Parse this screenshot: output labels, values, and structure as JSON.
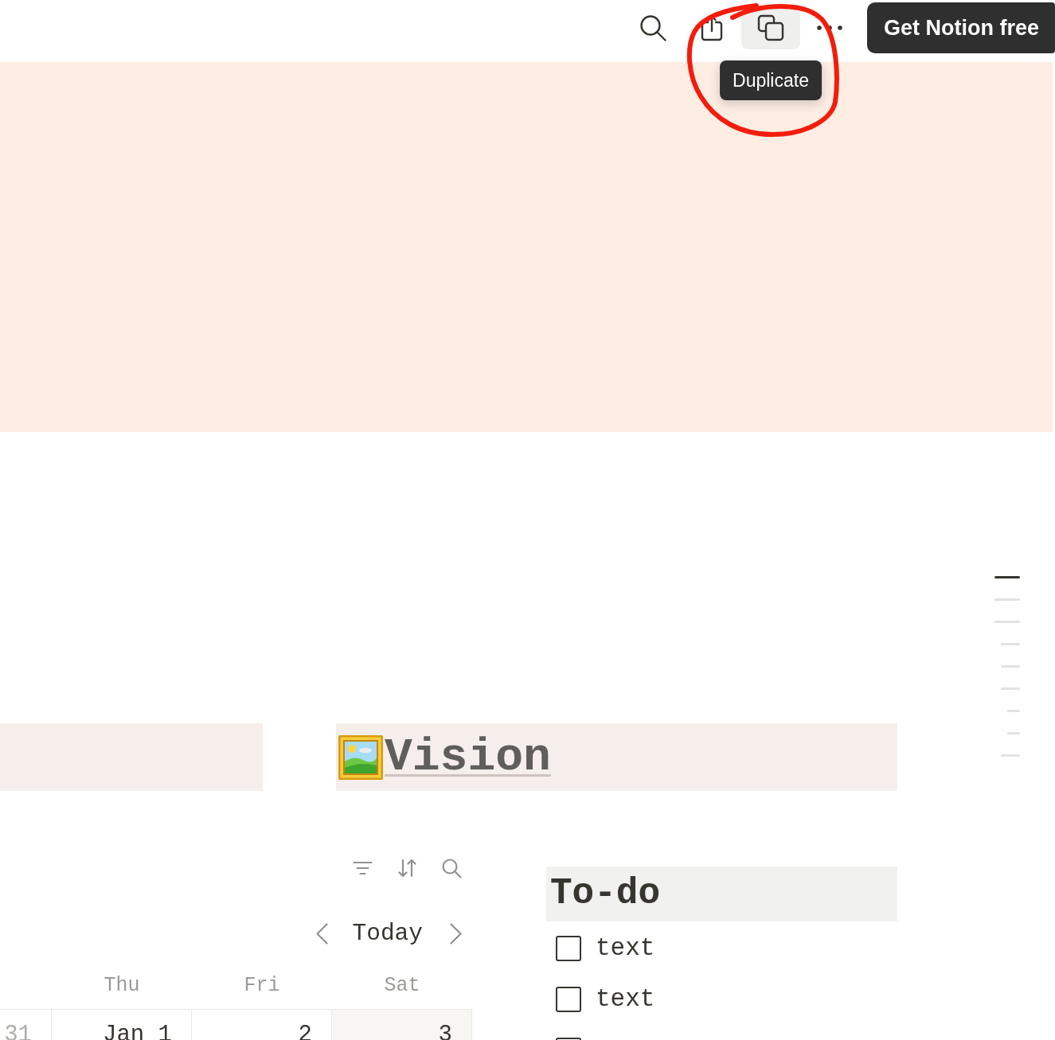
{
  "topbar": {
    "buttons": [
      {
        "kind": "search",
        "hovered": false
      },
      {
        "kind": "share",
        "hovered": false
      },
      {
        "kind": "duplicate",
        "hovered": true,
        "tooltip": "Duplicate"
      },
      {
        "kind": "more",
        "hovered": false
      }
    ],
    "cta": "Get Notion free"
  },
  "outline": [
    {
      "selected": true
    },
    {
      "selected": false
    },
    {
      "selected": false,
      "children": [
        {
          "selected": false
        },
        {
          "selected": false
        },
        {
          "selected": false,
          "children": [
            {
              "selected": false
            },
            {
              "selected": false
            }
          ]
        },
        {
          "selected": false
        }
      ]
    }
  ],
  "vision_link": {
    "title": "Vision"
  },
  "calendar": {
    "today": "Today",
    "weekdays": [
      "Thu",
      "Fri",
      "Sat"
    ],
    "cells": [
      {
        "day": "31",
        "current_month": false,
        "weekend": false
      },
      {
        "day": "Jan 1",
        "current_month": true,
        "weekend": false
      },
      {
        "day": "2",
        "current_month": true,
        "weekend": false
      },
      {
        "day": "3",
        "current_month": true,
        "weekend": true
      }
    ]
  },
  "todo": {
    "title": "To-do",
    "items": [
      {
        "text": "text",
        "checked": false
      },
      {
        "text": "text",
        "checked": false
      },
      {
        "checked": false
      }
    ]
  }
}
